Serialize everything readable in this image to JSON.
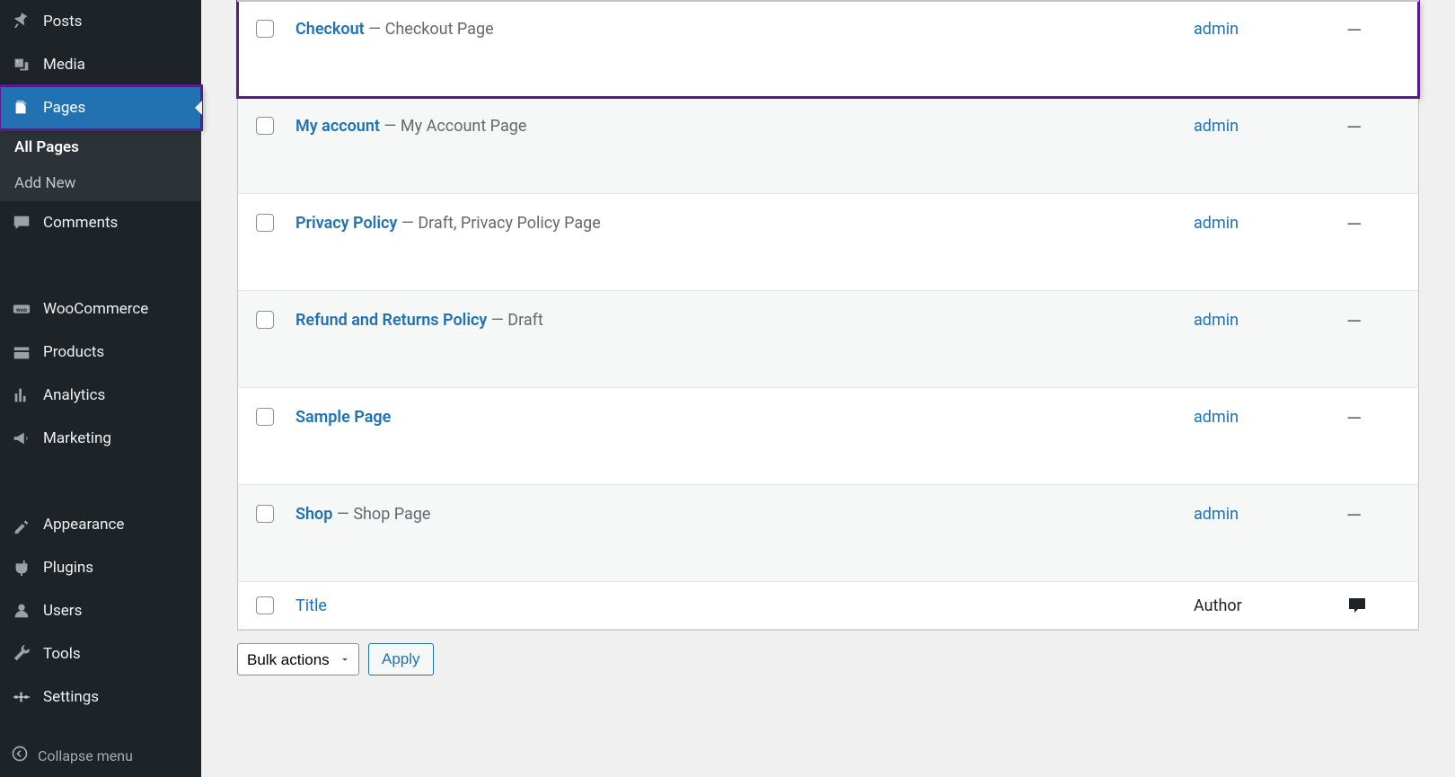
{
  "sidebar": {
    "items": [
      {
        "label": "Posts",
        "icon": "pin-icon"
      },
      {
        "label": "Media",
        "icon": "media-icon"
      },
      {
        "label": "Pages",
        "icon": "pages-icon",
        "active": true
      },
      {
        "label": "Comments",
        "icon": "comments-icon"
      },
      {
        "label": "WooCommerce",
        "icon": "woocommerce-icon"
      },
      {
        "label": "Products",
        "icon": "products-icon"
      },
      {
        "label": "Analytics",
        "icon": "analytics-icon"
      },
      {
        "label": "Marketing",
        "icon": "marketing-icon"
      },
      {
        "label": "Appearance",
        "icon": "appearance-icon"
      },
      {
        "label": "Plugins",
        "icon": "plugins-icon"
      },
      {
        "label": "Users",
        "icon": "users-icon"
      },
      {
        "label": "Tools",
        "icon": "tools-icon"
      },
      {
        "label": "Settings",
        "icon": "settings-icon"
      }
    ],
    "submenu": [
      {
        "label": "All Pages",
        "current": true
      },
      {
        "label": "Add New"
      }
    ],
    "collapse_label": "Collapse menu"
  },
  "table": {
    "rows": [
      {
        "title": "Checkout",
        "suffix": " — Checkout Page",
        "author": "admin",
        "highlighted": true
      },
      {
        "title": "My account",
        "suffix": " — My Account Page",
        "author": "admin"
      },
      {
        "title": "Privacy Policy",
        "suffix": " — Draft, Privacy Policy Page",
        "author": "admin"
      },
      {
        "title": "Refund and Returns Policy",
        "suffix": " — Draft",
        "author": "admin"
      },
      {
        "title": "Sample Page",
        "suffix": "",
        "author": "admin"
      },
      {
        "title": "Shop",
        "suffix": " — Shop Page",
        "author": "admin"
      }
    ],
    "footer": {
      "title_label": "Title",
      "author_label": "Author"
    },
    "dash": "—"
  },
  "bulk": {
    "select_label": "Bulk actions",
    "apply_label": "Apply"
  }
}
